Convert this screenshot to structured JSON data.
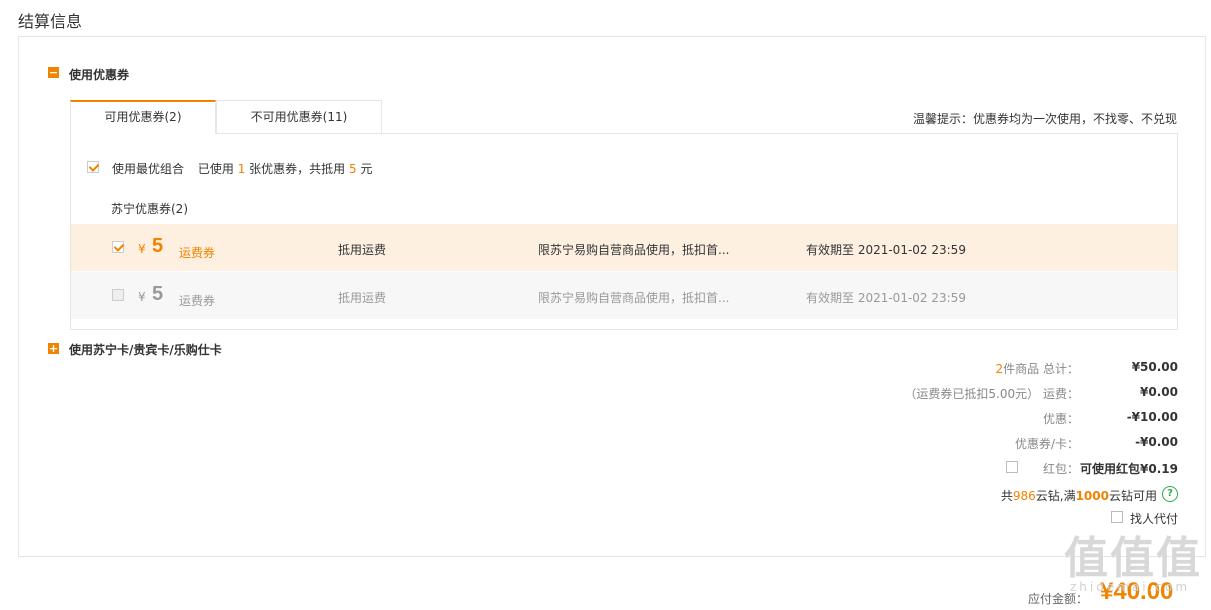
{
  "page": {
    "title": "结算信息"
  },
  "coupon_section": {
    "toggle_symbol": "−",
    "label": "使用优惠券",
    "tabs": [
      {
        "label": "可用优惠券(2)",
        "active": true
      },
      {
        "label": "不可用优惠券(11)",
        "active": false
      }
    ],
    "tip": "温馨提示：优惠券均为一次使用，不找零、不兑现",
    "best_combo": {
      "checked": true,
      "label": "使用最优组合",
      "prefix": "已使用",
      "count": "1",
      "mid": "张优惠券，共抵用",
      "amount": "5",
      "suffix": "元"
    },
    "group_title": "苏宁优惠券(2)",
    "coupons": [
      {
        "checked": true,
        "currency": "¥",
        "amount": "5",
        "type": "运费券",
        "usage": "抵用运费",
        "scope": "限苏宁易购自营商品使用，抵扣首...",
        "validity": "有效期至 2021-01-02 23:59"
      },
      {
        "checked": false,
        "currency": "¥",
        "amount": "5",
        "type": "运费券",
        "usage": "抵用运费",
        "scope": "限苏宁易购自营商品使用，抵扣首...",
        "validity": "有效期至 2021-01-02 23:59"
      }
    ]
  },
  "card_section": {
    "toggle_symbol": "+",
    "label": "使用苏宁卡/贵宾卡/乐购仕卡"
  },
  "summary": {
    "items_count": "2",
    "items_label": "件商品 总计：",
    "items_total": "¥50.00",
    "shipping_note": "（运费券已抵扣5.00元）",
    "shipping_label": "运费：",
    "shipping_value": "¥0.00",
    "discount_label": "优惠：",
    "discount_value": "-¥10.00",
    "coupon_card_label": "优惠券/卡：",
    "coupon_card_value": "-¥0.00",
    "redpacket_label": "红包：",
    "redpacket_value": "可使用红包¥0.19",
    "yunzuan_prefix": "共",
    "yunzuan_count": "986",
    "yunzuan_mid": "云钻,满",
    "yunzuan_threshold": "1000",
    "yunzuan_suffix": "云钻可用",
    "proxy_pay_label": "找人代付",
    "payable_label": "应付金额：",
    "payable_value": "¥40.00"
  },
  "watermark": {
    "text": "值值值",
    "sub": "zhidemai.com"
  },
  "colors": {
    "accent": "#f08300",
    "selected_row": "#fdf0e1",
    "help_green": "#2fa84f"
  }
}
